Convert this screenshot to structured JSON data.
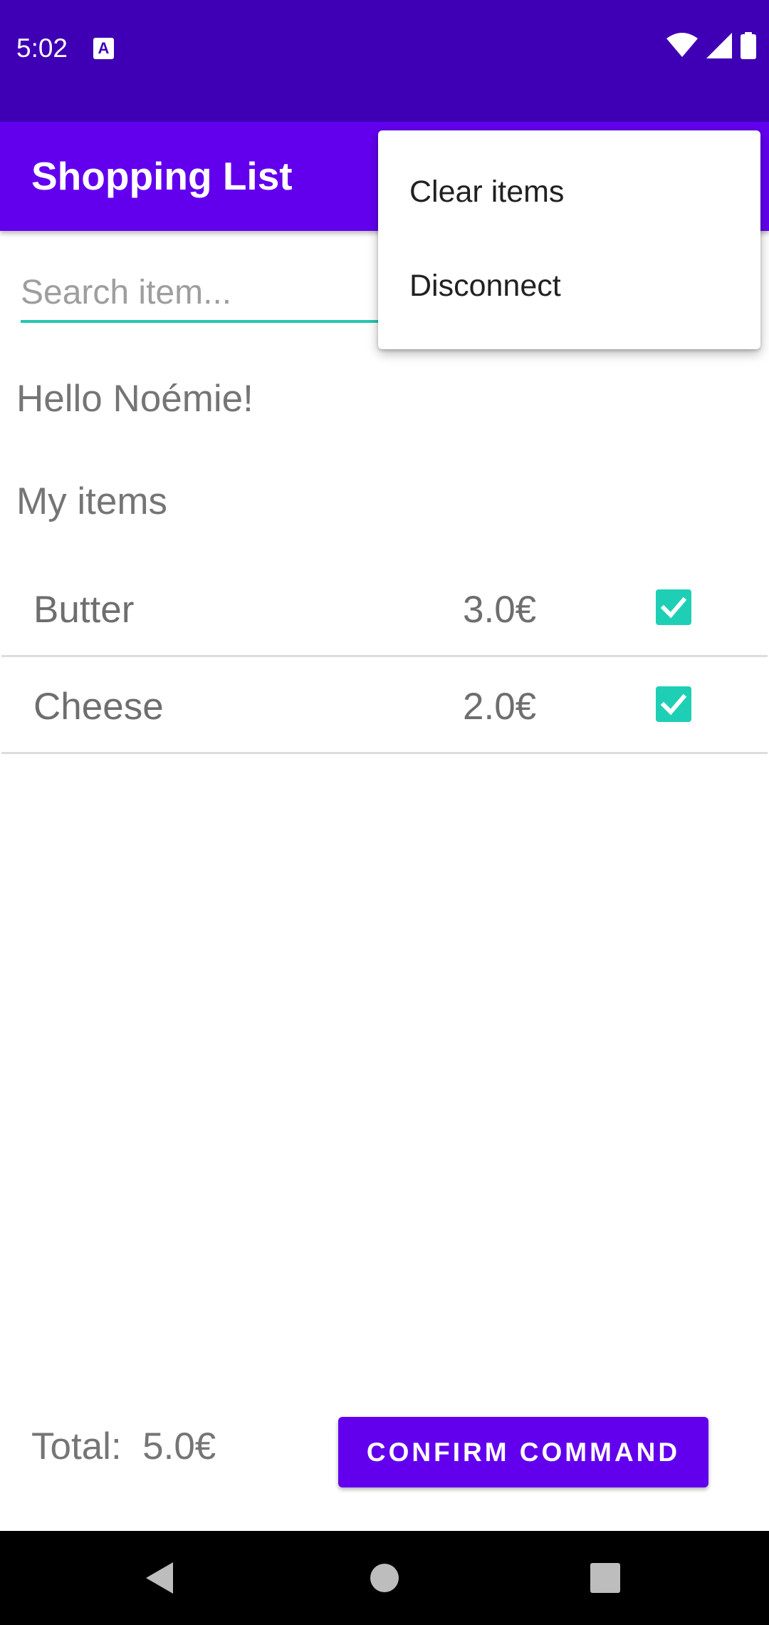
{
  "status_bar": {
    "time": "5:02",
    "notification_icon": "A",
    "icons": [
      "wifi-icon",
      "signal-icon",
      "battery-icon"
    ]
  },
  "app_bar": {
    "title": "Shopping List"
  },
  "search": {
    "placeholder": "Search item...",
    "value": ""
  },
  "greeting": "Hello Noémie!",
  "section_title": "My items",
  "items": [
    {
      "name": "Butter",
      "price": "3.0€",
      "checked": true
    },
    {
      "name": "Cheese",
      "price": "2.0€",
      "checked": true
    }
  ],
  "footer": {
    "total_label": "Total:  5.0€",
    "confirm_label": "CONFIRM COMMAND"
  },
  "overflow_menu": {
    "items": [
      "Clear items",
      "Disconnect"
    ]
  },
  "nav_bar": {
    "icons": [
      "back-icon",
      "home-icon",
      "recents-icon"
    ]
  },
  "colors": {
    "status_bar": "#3F00B5",
    "app_bar": "#6200EE",
    "accent": "#1ECFB6",
    "button": "#6200EE"
  }
}
